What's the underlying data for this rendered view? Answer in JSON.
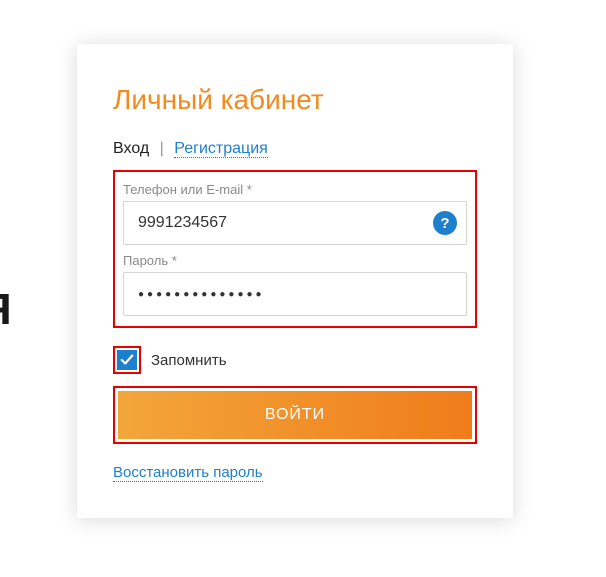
{
  "sideText": "Я",
  "card": {
    "title": "Личный кабинет",
    "tabs": {
      "login": "Вход",
      "divider": "|",
      "register": "Регистрация"
    },
    "fields": {
      "phoneLabel": "Телефон или E-mail *",
      "phoneValue": "9991234567",
      "helpSymbol": "?",
      "passwordLabel": "Пароль *",
      "passwordMasked": "●●●●●●●●●●●●●●"
    },
    "remember": {
      "label": "Запомнить",
      "checked": true
    },
    "submit": "ВОЙТИ",
    "forgot": "Восстановить пароль"
  }
}
